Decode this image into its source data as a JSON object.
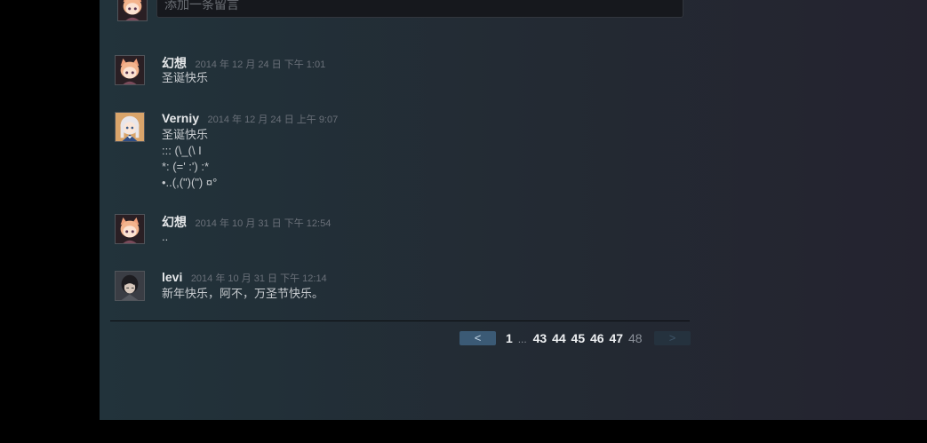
{
  "reply": {
    "placeholder": "添加一条留言"
  },
  "comments": [
    {
      "author": "幻想",
      "time": "2014 年 12 月 24 日 下午 1:01",
      "text": "圣诞快乐",
      "avatar": "anime-girl-catears-avatar"
    },
    {
      "author": "Verniy",
      "time": "2014 年 12 月 24 日 上午 9:07",
      "text": "圣诞快乐\n::: (\\_(\\ I\n*: (=' :') :*\n•..(,(\")(\") ¤°",
      "avatar": "anime-girl-silver-hair-avatar"
    },
    {
      "author": "幻想",
      "time": "2014 年 10 月 31 日 下午 12:54",
      "text": "..",
      "avatar": "anime-girl-catears-avatar"
    },
    {
      "author": "levi",
      "time": "2014 年 10 月 31 日 下午 12:14",
      "text": "新年快乐，阿不，万圣节快乐。",
      "avatar": "anime-man-dark-hair-avatar"
    }
  ],
  "pagination": {
    "prev_label": "<",
    "next_label": ">",
    "first_page": "1",
    "ellipsis": "...",
    "pages": [
      "43",
      "44",
      "45",
      "46",
      "47"
    ],
    "current": "48"
  },
  "colors": {
    "panel_left": "#22333b",
    "panel_right": "#24232f",
    "prev_button": "#3b5a75",
    "next_button_disabled": "#25323e"
  }
}
